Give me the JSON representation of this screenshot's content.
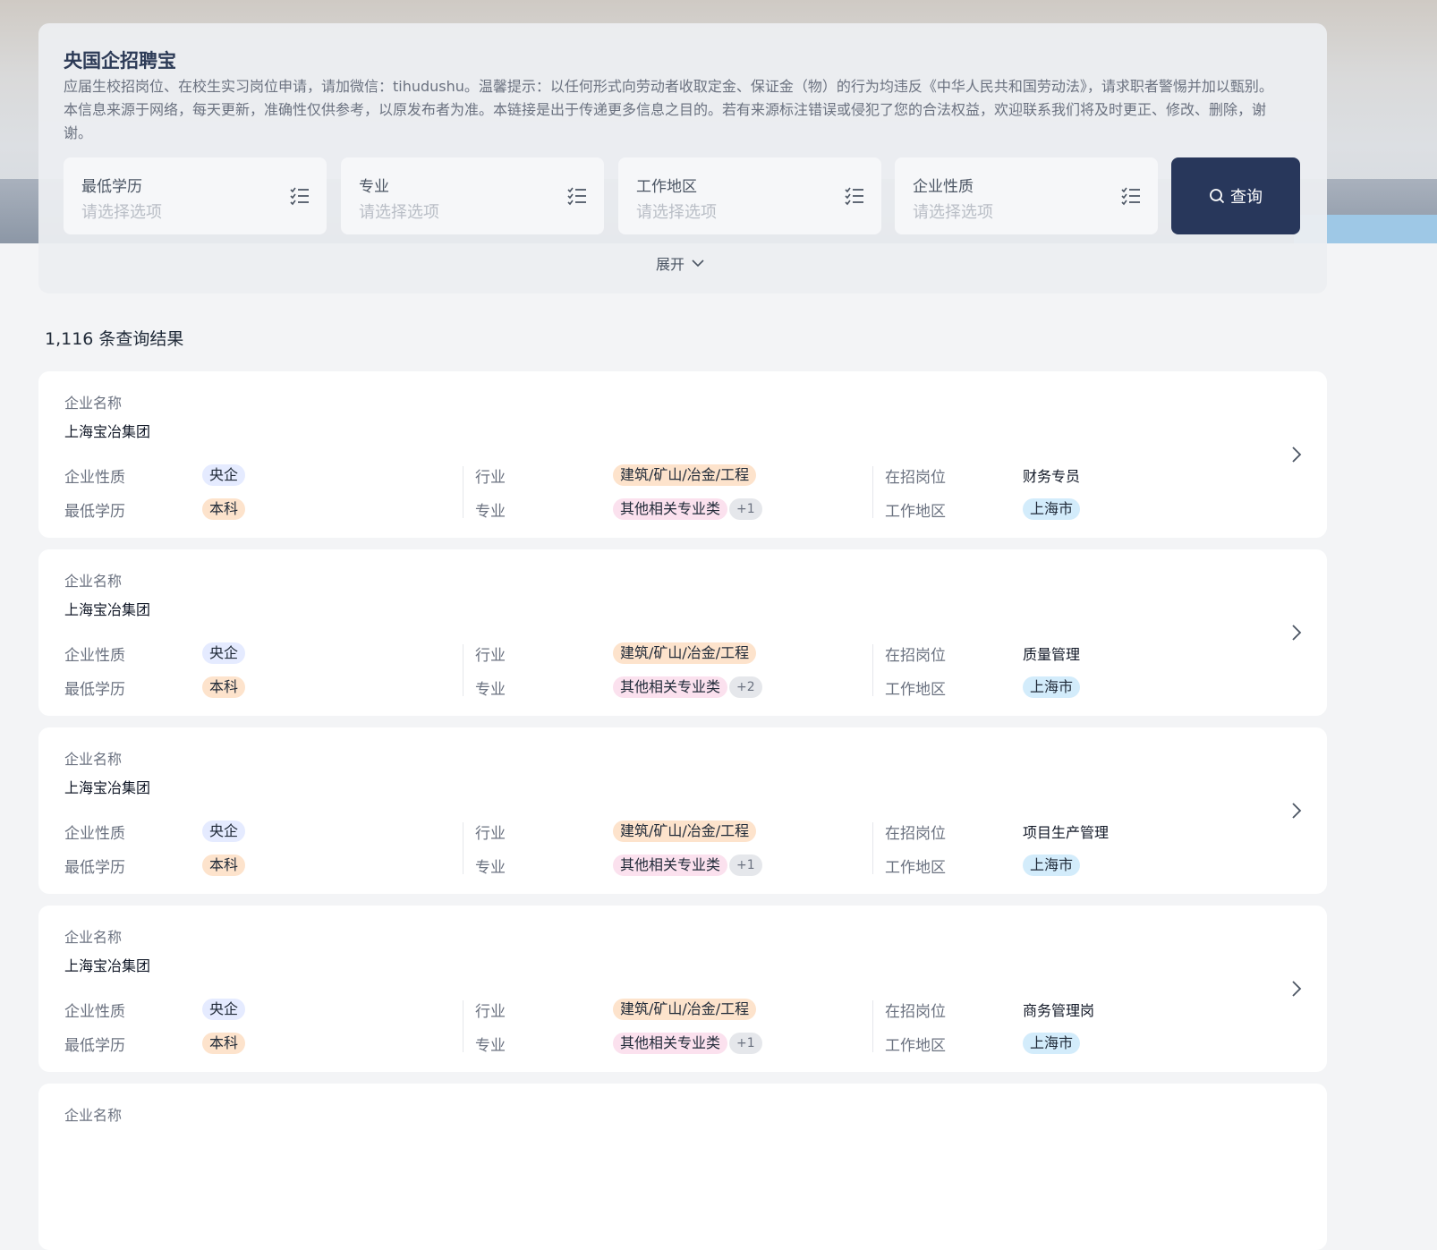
{
  "panel": {
    "title": "央国企招聘宝",
    "description": "应届生校招岗位、在校生实习岗位申请，请加微信：tihudushu。温馨提示：以任何形式向劳动者收取定金、保证金（物）的行为均违反《中华人民共和国劳动法》，请求职者警惕并加以甄别。本信息来源于网络，每天更新，准确性仅供参考，以原发布者为准。本链接是出于传递更多信息之目的。若有来源标注错误或侵犯了您的合法权益，欢迎联系我们将及时更正、修改、删除，谢谢。",
    "filters": [
      {
        "label": "最低学历",
        "placeholder": "请选择选项",
        "icon": "checklist-icon"
      },
      {
        "label": "专业",
        "placeholder": "请选择选项",
        "icon": "checklist-icon"
      },
      {
        "label": "工作地区",
        "placeholder": "请选择选项",
        "icon": "checklist-icon"
      },
      {
        "label": "企业性质",
        "placeholder": "请选择选项",
        "icon": "checklist-icon"
      }
    ],
    "search_label": "查询",
    "expand_label": "展开"
  },
  "results": {
    "count_text": "1,116 条查询结果"
  },
  "labels": {
    "company_name": "企业名称",
    "company_type": "企业性质",
    "min_education": "最低学历",
    "industry": "行业",
    "major": "专业",
    "position": "在招岗位",
    "work_area": "工作地区"
  },
  "cards": [
    {
      "company": "上海宝冶集团",
      "type": "央企",
      "education": "本科",
      "industry": "建筑/矿山/冶金/工程",
      "major": "其他相关专业类",
      "major_extra": "+1",
      "position": "财务专员",
      "area": "上海市"
    },
    {
      "company": "上海宝冶集团",
      "type": "央企",
      "education": "本科",
      "industry": "建筑/矿山/冶金/工程",
      "major": "其他相关专业类",
      "major_extra": "+2",
      "position": "质量管理",
      "area": "上海市"
    },
    {
      "company": "上海宝冶集团",
      "type": "央企",
      "education": "本科",
      "industry": "建筑/矿山/冶金/工程",
      "major": "其他相关专业类",
      "major_extra": "+1",
      "position": "项目生产管理",
      "area": "上海市"
    },
    {
      "company": "上海宝冶集团",
      "type": "央企",
      "education": "本科",
      "industry": "建筑/矿山/冶金/工程",
      "major": "其他相关专业类",
      "major_extra": "+1",
      "position": "商务管理岗",
      "area": "上海市"
    }
  ]
}
